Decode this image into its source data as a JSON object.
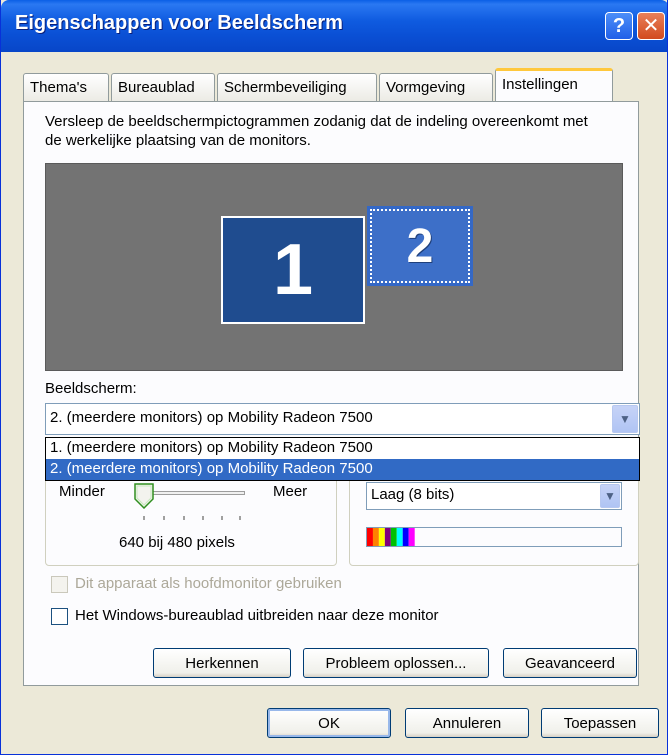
{
  "window": {
    "title": "Eigenschappen voor Beeldscherm",
    "help_glyph": "?",
    "close_glyph": "✕"
  },
  "tabs": [
    {
      "label": "Thema's"
    },
    {
      "label": "Bureaublad"
    },
    {
      "label": "Schermbeveiliging"
    },
    {
      "label": "Vormgeving"
    },
    {
      "label": "Instellingen",
      "active": true
    }
  ],
  "settings": {
    "description": "Versleep de beeldschermpictogrammen zodanig dat de indeling overeenkomt met de werkelijke plaatsing van de monitors.",
    "monitor_1_label": "1",
    "monitor_2_label": "2",
    "display_label": "Beeldscherm:",
    "display_selected": "2. (meerdere monitors) op Mobility Radeon 7500",
    "display_options": [
      "1. (meerdere monitors) op Mobility Radeon 7500",
      "2. (meerdere monitors) op Mobility Radeon 7500"
    ],
    "resolution": {
      "less_label": "Minder",
      "more_label": "Meer",
      "value_text": "640 bij 480 pixels",
      "slider_fraction": 0.0
    },
    "color_quality": {
      "selected": "Laag (8 bits)"
    },
    "primary_checkbox": {
      "label": "Dit apparaat als hoofdmonitor gebruiken",
      "checked": false,
      "disabled": true
    },
    "extend_checkbox": {
      "label": "Het Windows-bureaublad uitbreiden naar deze monitor",
      "checked": false,
      "disabled": false
    },
    "buttons": {
      "identify": "Herkennen",
      "troubleshoot": "Probleem oplossen...",
      "advanced": "Geavanceerd"
    }
  },
  "footer": {
    "ok": "OK",
    "cancel": "Annuleren",
    "apply": "Toepassen"
  },
  "colors": {
    "titlebar": "#0A4FD4",
    "monitor_primary": "#1F4C8F",
    "monitor_selected": "#3D6FC8",
    "preview_bg": "#737373",
    "selection": "#316AC5"
  }
}
